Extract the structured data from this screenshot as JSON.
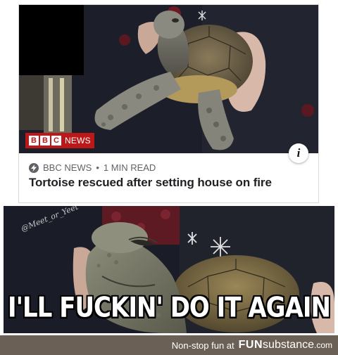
{
  "news_card": {
    "logo_letters": [
      "B",
      "B",
      "C"
    ],
    "logo_word": "NEWS",
    "info_icon": "i",
    "source": "BBC NEWS",
    "separator": "•",
    "read_time": "1 MIN READ",
    "headline": "Tortoise rescued after setting house on fire"
  },
  "meme": {
    "watermark": "@Meet_or_Yeet",
    "caption": "I'LL FUCKIN' DO IT AGAIN"
  },
  "footer": {
    "tagline": "Non-stop fun at",
    "brand_fun": "FUN",
    "brand_sub": "substance",
    "brand_domain": ".com"
  },
  "colors": {
    "bbc_red": "#bb1919",
    "footer_bg": "#6b6055"
  }
}
